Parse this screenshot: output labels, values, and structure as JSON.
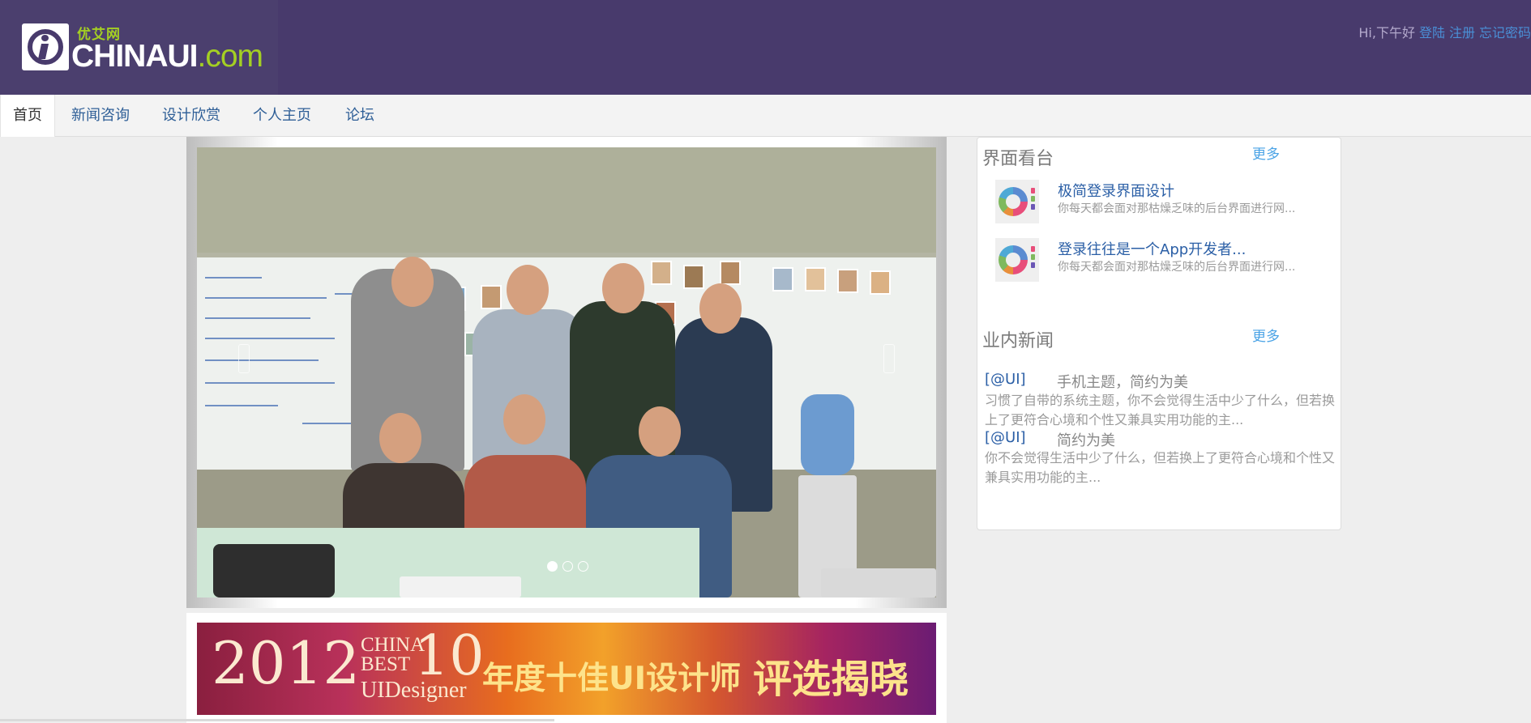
{
  "header": {
    "logo": {
      "cn": "优艾网",
      "en_main": "CHINAUI",
      "en_suffix": ".com"
    },
    "greeting": "Hi,下午好",
    "login": "登陆",
    "register": "注册",
    "forgot": "忘记密码"
  },
  "nav": {
    "items": [
      "首页",
      "新闻咨询",
      "设计欣赏",
      "个人主页",
      "论坛"
    ],
    "active_index": 0
  },
  "carousel": {
    "slide_count": 3,
    "active_slide": 0
  },
  "banner": {
    "year": "2012",
    "china": "CHINA",
    "best": "BEST",
    "ten": "10",
    "uidesigner": "UIDesigner",
    "title": "年度十佳UI设计师",
    "reveal": "评选揭晓"
  },
  "sidebar": {
    "showcase": {
      "title": "界面看台",
      "more": "更多",
      "items": [
        {
          "title": "极简登录界面设计",
          "desc": "你每天都会面对那枯燥乏味的后台界面进行网..."
        },
        {
          "title": "登录往往是一个App开发者...",
          "desc": "你每天都会面对那枯燥乏味的后台界面进行网..."
        }
      ]
    },
    "news": {
      "title": "业内新闻",
      "more": "更多",
      "items": [
        {
          "tag": "[@UI]",
          "headline": "手机主题，简约为美",
          "body": "习惯了自带的系统主题，你不会觉得生活中少了什么，但若换上了更符合心境和个性又兼具实用功能的主..."
        },
        {
          "tag": "[@UI]",
          "headline": "简约为美",
          "body": "你不会觉得生活中少了什么，但若换上了更符合心境和个性又兼具实用功能的主..."
        }
      ]
    }
  },
  "colors": {
    "header_bg": "#483a6c",
    "link_blue": "#4a8fd6",
    "logo_green": "#a4cf23",
    "more_blue": "#4aa3e6"
  }
}
